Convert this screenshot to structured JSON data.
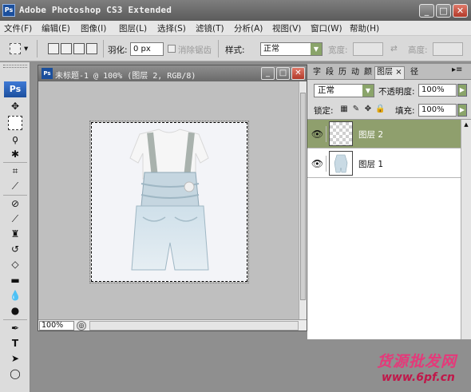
{
  "window": {
    "title": "Adobe Photoshop CS3 Extended",
    "app_icon": "Ps"
  },
  "menu": [
    "文件(F)",
    "编辑(E)",
    "图像(I)",
    "图层(L)",
    "选择(S)",
    "滤镜(T)",
    "分析(A)",
    "视图(V)",
    "窗口(W)",
    "帮助(H)"
  ],
  "options": {
    "feather_label": "羽化:",
    "feather_value": "0 px",
    "antialias_label": "消除锯齿",
    "style_label": "样式:",
    "style_value": "正常",
    "width_label": "宽度:",
    "height_label": "高度:"
  },
  "toolbox": {
    "badge": "Ps"
  },
  "document": {
    "icon": "Ps",
    "title": "未标题-1 @ 100% (图层 2, RGB/8)",
    "zoom": "100%"
  },
  "panel": {
    "tabs": [
      "字",
      "段",
      "历",
      "动",
      "颜",
      "图层",
      "径"
    ],
    "tab_close": "×",
    "blend_mode": "正常",
    "opacity_label": "不透明度:",
    "opacity_value": "100%",
    "lock_label": "锁定:",
    "fill_label": "填充:",
    "fill_value": "100%",
    "layers": [
      {
        "name": "图层 2",
        "selected": true
      },
      {
        "name": "图层 1",
        "selected": false
      }
    ]
  },
  "watermark": {
    "text": "货源批发网",
    "url": "www.6pf.cn"
  },
  "colors": {
    "selected_layer": "#8f9f6d",
    "title_bar": "#6a6a6a",
    "arrow_annotation": "#e5397a"
  }
}
